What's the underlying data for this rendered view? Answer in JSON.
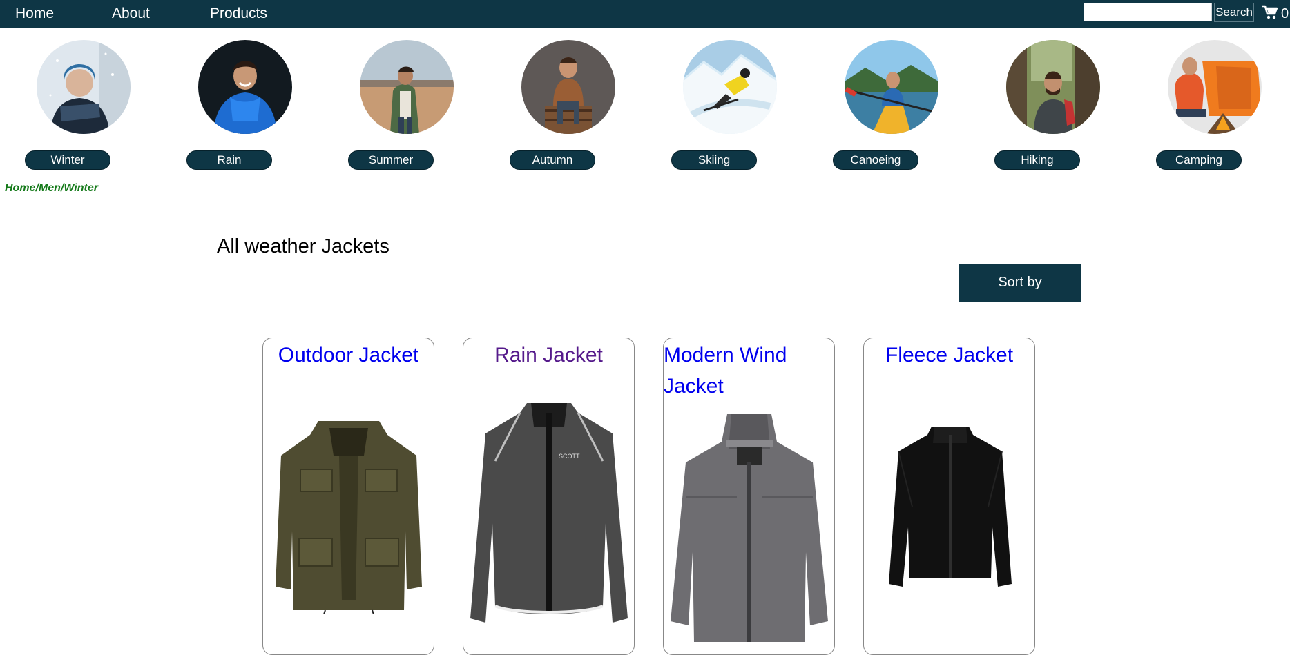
{
  "nav": {
    "links": [
      "Home",
      "About",
      "Products"
    ],
    "search_placeholder": "",
    "search_button": "Search",
    "cart_count": "0",
    "cart_icon": "cart-icon"
  },
  "categories": [
    {
      "label": "Winter",
      "image": "winter-category-image"
    },
    {
      "label": "Rain",
      "image": "rain-category-image"
    },
    {
      "label": "Summer",
      "image": "summer-category-image"
    },
    {
      "label": "Autumn",
      "image": "autumn-category-image"
    },
    {
      "label": "Skiing",
      "image": "skiing-category-image"
    },
    {
      "label": "Canoeing",
      "image": "canoeing-category-image"
    },
    {
      "label": "Hiking",
      "image": "hiking-category-image"
    },
    {
      "label": "Camping",
      "image": "camping-category-image"
    }
  ],
  "breadcrumb": "Home/Men/Winter",
  "page_title": "All weather Jackets",
  "sort_button": "Sort by",
  "products": [
    {
      "title": "Outdoor Jacket",
      "image": "outdoor-jacket-image"
    },
    {
      "title": "Rain Jacket",
      "image": "rain-jacket-image"
    },
    {
      "title": "Modern Wind Jacket",
      "image": "modern-wind-jacket-image"
    },
    {
      "title": "Fleece Jacket",
      "image": "fleece-jacket-image"
    }
  ],
  "colors": {
    "nav_bg": "#0e3645",
    "breadcrumb": "#157a1a",
    "link": "#0000ee",
    "visited_link": "#551a8b"
  }
}
